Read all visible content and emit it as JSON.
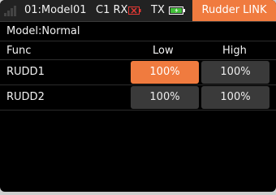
{
  "status_bar": {
    "model": "01:Model01",
    "rx_label": "C1 RX",
    "tx_label": "TX",
    "page_title": "Rudder LINK",
    "icons": {
      "signal": "signal-bars-icon",
      "rx": "rx-disconnected-icon",
      "tx": "battery-icon"
    },
    "colors": {
      "accent": "#f07b3f",
      "rx_bad": "#e53935",
      "battery": "#43c23b"
    }
  },
  "subtitle": "Model:Normal",
  "table": {
    "columns": [
      "Func",
      "Low",
      "High"
    ],
    "rows": [
      {
        "name": "RUDD1",
        "low": "100%",
        "high": "100%",
        "low_selected": true
      },
      {
        "name": "RUDD2",
        "low": "100%",
        "high": "100%",
        "low_selected": false
      }
    ]
  }
}
